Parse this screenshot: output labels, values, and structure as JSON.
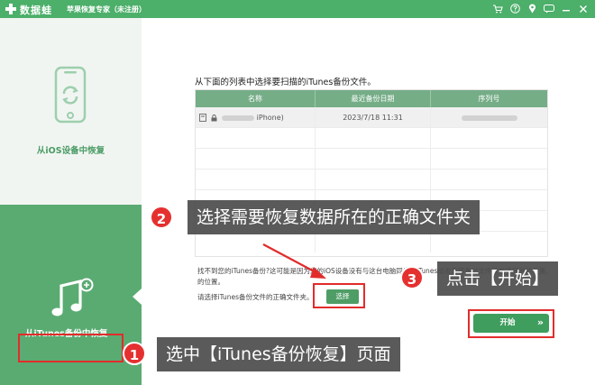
{
  "titlebar": {
    "app_name": "数据蛙",
    "subtitle": "苹果恢复专家（未注册）",
    "icons": [
      "cart-icon",
      "question-icon",
      "location-icon",
      "chat-icon",
      "minimize-icon",
      "close-icon"
    ]
  },
  "sidebar": {
    "ios_label": "从iOS设备中恢复",
    "itunes_label": "从iTunes备份中恢复"
  },
  "main": {
    "instruction": "从下面的列表中选择要扫描的iTunes备份文件。",
    "table": {
      "headers": [
        "名称",
        "最近备份日期",
        "序列号"
      ],
      "rows": [
        {
          "name_suffix": "iPhone)",
          "date": "2023/7/18 11:31"
        }
      ]
    },
    "note_line1": "找不到您的iTunes备份?这可能是因为您的iOS设备没有与这台电脑同步过iTunes或者您将备份文件放在了其他的位置。",
    "note_line2": "的位置。",
    "choose_prompt": "请选择iTunes备份文件的正确文件夹。",
    "choose_button": "选择",
    "start_button": "开始",
    "start_chevron": "»"
  },
  "annotations": [
    {
      "number": "1",
      "text": "选中【iTunes备份恢复】页面"
    },
    {
      "number": "2",
      "text": "选择需要恢复数据所在的正确文件夹"
    },
    {
      "number": "3",
      "text": "点击【开始】"
    }
  ],
  "colors": {
    "brand_green": "#4caf6a",
    "sidebar_active": "#5aab72",
    "table_header": "#75ad87",
    "highlight_red": "#e22c2c",
    "callout_bg": "#4e4e4e"
  }
}
